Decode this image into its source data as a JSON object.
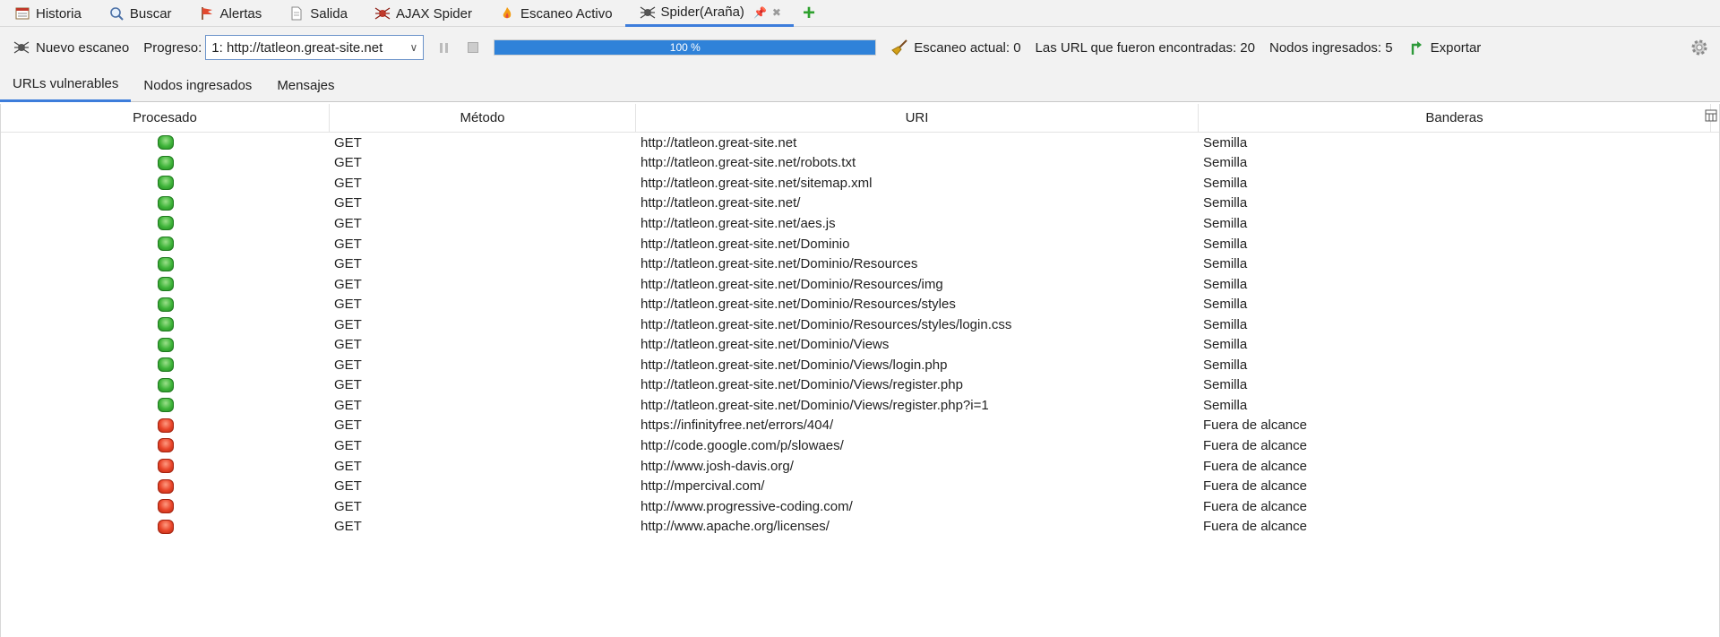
{
  "tabs": [
    {
      "label": "Historia",
      "icon": "history-icon"
    },
    {
      "label": "Buscar",
      "icon": "search-icon"
    },
    {
      "label": "Alertas",
      "icon": "alerts-flag-icon"
    },
    {
      "label": "Salida",
      "icon": "output-document-icon"
    },
    {
      "label": "AJAX Spider",
      "icon": "ajax-spider-icon"
    },
    {
      "label": "Escaneo Activo",
      "icon": "active-scan-flame-icon"
    },
    {
      "label": "Spider(Araña)",
      "icon": "spider-icon",
      "active": true
    }
  ],
  "toolbar": {
    "new_scan": "Nuevo escaneo",
    "progress_label": "Progreso:",
    "progress_select": "1: http://tatleon.great-site.net",
    "progress_percent": 100,
    "progress_text": "100 %",
    "current_scan": "Escaneo actual: 0",
    "urls_found": "Las URL que fueron encontradas: 20",
    "nodes_added": "Nodos ingresados: 5",
    "export": "Exportar"
  },
  "subtabs": [
    {
      "label": "URLs vulnerables",
      "active": true
    },
    {
      "label": "Nodos ingresados"
    },
    {
      "label": "Mensajes"
    }
  ],
  "table": {
    "headers": [
      "Procesado",
      "Método",
      "URI",
      "Banderas"
    ],
    "rows": [
      {
        "status": "ok",
        "method": "GET",
        "uri": "http://tatleon.great-site.net",
        "flag": "Semilla"
      },
      {
        "status": "ok",
        "method": "GET",
        "uri": "http://tatleon.great-site.net/robots.txt",
        "flag": "Semilla"
      },
      {
        "status": "ok",
        "method": "GET",
        "uri": "http://tatleon.great-site.net/sitemap.xml",
        "flag": "Semilla"
      },
      {
        "status": "ok",
        "method": "GET",
        "uri": "http://tatleon.great-site.net/",
        "flag": "Semilla"
      },
      {
        "status": "ok",
        "method": "GET",
        "uri": "http://tatleon.great-site.net/aes.js",
        "flag": "Semilla"
      },
      {
        "status": "ok",
        "method": "GET",
        "uri": "http://tatleon.great-site.net/Dominio",
        "flag": "Semilla"
      },
      {
        "status": "ok",
        "method": "GET",
        "uri": "http://tatleon.great-site.net/Dominio/Resources",
        "flag": "Semilla"
      },
      {
        "status": "ok",
        "method": "GET",
        "uri": "http://tatleon.great-site.net/Dominio/Resources/img",
        "flag": "Semilla"
      },
      {
        "status": "ok",
        "method": "GET",
        "uri": "http://tatleon.great-site.net/Dominio/Resources/styles",
        "flag": "Semilla"
      },
      {
        "status": "ok",
        "method": "GET",
        "uri": "http://tatleon.great-site.net/Dominio/Resources/styles/login.css",
        "flag": "Semilla"
      },
      {
        "status": "ok",
        "method": "GET",
        "uri": "http://tatleon.great-site.net/Dominio/Views",
        "flag": "Semilla"
      },
      {
        "status": "ok",
        "method": "GET",
        "uri": "http://tatleon.great-site.net/Dominio/Views/login.php",
        "flag": "Semilla"
      },
      {
        "status": "ok",
        "method": "GET",
        "uri": "http://tatleon.great-site.net/Dominio/Views/register.php",
        "flag": "Semilla"
      },
      {
        "status": "ok",
        "method": "GET",
        "uri": "http://tatleon.great-site.net/Dominio/Views/register.php?i=1",
        "flag": "Semilla"
      },
      {
        "status": "bad",
        "method": "GET",
        "uri": "https://infinityfree.net/errors/404/",
        "flag": "Fuera de alcance"
      },
      {
        "status": "bad",
        "method": "GET",
        "uri": "http://code.google.com/p/slowaes/",
        "flag": "Fuera de alcance"
      },
      {
        "status": "bad",
        "method": "GET",
        "uri": "http://www.josh-davis.org/",
        "flag": "Fuera de alcance"
      },
      {
        "status": "bad",
        "method": "GET",
        "uri": "http://mpercival.com/",
        "flag": "Fuera de alcance"
      },
      {
        "status": "bad",
        "method": "GET",
        "uri": "http://www.progressive-coding.com/",
        "flag": "Fuera de alcance"
      },
      {
        "status": "bad",
        "method": "GET",
        "uri": "http://www.apache.org/licenses/",
        "flag": "Fuera de alcance"
      }
    ]
  },
  "colors": {
    "accent": "#3d7ddb",
    "progress": "#2f82d9",
    "ok": "#3fb43a",
    "bad": "#e8452a"
  }
}
